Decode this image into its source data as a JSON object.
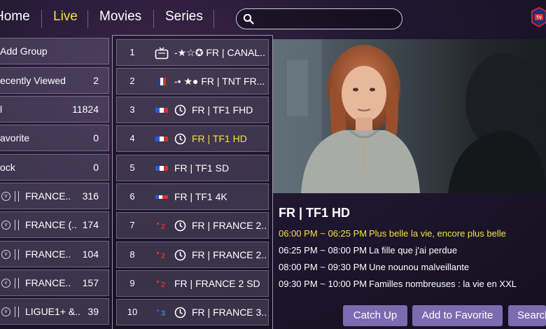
{
  "nav": {
    "items": [
      "Home",
      "Live",
      "Movies",
      "Series"
    ],
    "active": "Live",
    "search_placeholder": ""
  },
  "logo": {
    "text": "TV"
  },
  "groups": [
    {
      "label": "Add Group",
      "count": ""
    },
    {
      "label": "ecently Viewed",
      "count": "2"
    },
    {
      "label": "l",
      "count": "11824"
    },
    {
      "label": "avorite",
      "count": "0"
    },
    {
      "label": "ock",
      "count": "0"
    },
    {
      "label": "FRANCE..",
      "count": "316"
    },
    {
      "label": "FRANCE (..",
      "count": "174"
    },
    {
      "label": "FRANCE..",
      "count": "104"
    },
    {
      "label": "FRANCE..",
      "count": "157"
    },
    {
      "label": "LIGUE1+ &..",
      "count": "39"
    }
  ],
  "channels": [
    {
      "num": "1",
      "name": "-★☆✪ FR | CANAL..."
    },
    {
      "num": "2",
      "name": "-• ★● FR | TNT FR..."
    },
    {
      "num": "3",
      "name": "FR | TF1 FHD"
    },
    {
      "num": "4",
      "name": "FR | TF1 HD"
    },
    {
      "num": "5",
      "name": "FR | TF1 SD"
    },
    {
      "num": "6",
      "name": "FR | TF1 4K"
    },
    {
      "num": "7",
      "name": "FR | FRANCE 2..."
    },
    {
      "num": "8",
      "name": "FR | FRANCE 2..."
    },
    {
      "num": "9",
      "name": "FR | FRANCE 2 SD"
    },
    {
      "num": "10",
      "name": "FR | FRANCE 3..."
    }
  ],
  "epg": {
    "channel_title": "FR | TF1 HD",
    "programs": [
      {
        "time": "06:00 PM ~ 06:25 PM",
        "title": "Plus belle la vie, encore plus belle"
      },
      {
        "time": "06:25 PM ~ 08:00 PM",
        "title": "La fille que j'ai perdue"
      },
      {
        "time": "08:00 PM ~ 09:30 PM",
        "title": "Une nounou malveillante"
      },
      {
        "time": "09:30 PM ~ 10:00 PM",
        "title": "Familles nombreuses : la vie en XXL"
      }
    ]
  },
  "actions": {
    "catch_up": "Catch Up",
    "add_favorite": "Add to Favorite",
    "search": "Search"
  },
  "colors": {
    "accent_yellow": "#f2e341",
    "button_purple": "#7c6bb1"
  }
}
